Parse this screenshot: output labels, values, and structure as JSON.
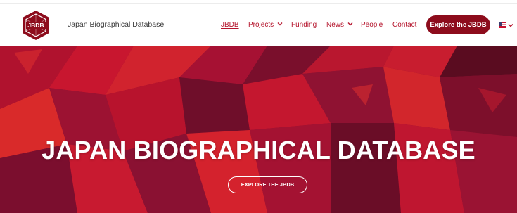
{
  "colors": {
    "brand": "#8d0c1c",
    "nav_text": "#b5142c",
    "hero_base": "#8a1230"
  },
  "header": {
    "logo_text": "JBDB",
    "site_name": "Japan Biographical Database"
  },
  "nav": {
    "items": [
      {
        "label": "JBDB",
        "active": true,
        "dropdown": false
      },
      {
        "label": "Projects",
        "active": false,
        "dropdown": true
      },
      {
        "label": "Funding",
        "active": false,
        "dropdown": false
      },
      {
        "label": "News",
        "active": false,
        "dropdown": true
      },
      {
        "label": "People",
        "active": false,
        "dropdown": false
      },
      {
        "label": "Contact",
        "active": false,
        "dropdown": false
      }
    ],
    "cta_label": "Explore the JBDB",
    "language_icon": "us-flag-icon"
  },
  "hero": {
    "title": "JAPAN BIOGRAPHICAL DATABASE",
    "button_label": "EXPLORE THE JBDB"
  }
}
